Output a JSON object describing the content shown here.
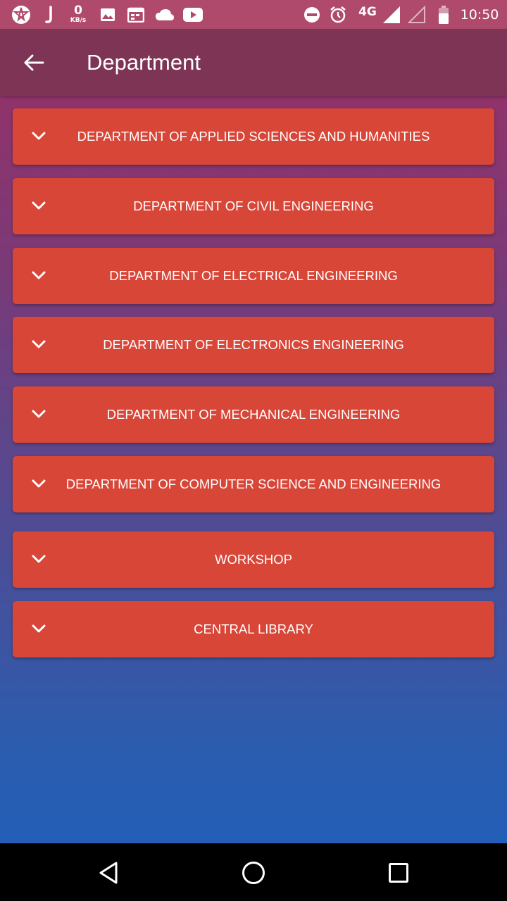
{
  "status_bar": {
    "speed_value": "0",
    "speed_unit": "KB/s",
    "network": "4G",
    "time": "10:50"
  },
  "header": {
    "title": "Department",
    "back_icon": "arrow-left-icon"
  },
  "departments": [
    {
      "label": "DEPARTMENT OF APPLIED SCIENCES AND HUMANITIES"
    },
    {
      "label": "DEPARTMENT OF CIVIL ENGINEERING"
    },
    {
      "label": "DEPARTMENT OF ELECTRICAL ENGINEERING"
    },
    {
      "label": "DEPARTMENT OF ELECTRONICS ENGINEERING"
    },
    {
      "label": "DEPARTMENT OF MECHANICAL ENGINEERING"
    },
    {
      "label": "DEPARTMENT OF COMPUTER SCIENCE AND ENGINEERING"
    },
    {
      "label": "WORKSHOP"
    },
    {
      "label": "CENTRAL LIBRARY"
    }
  ],
  "colors": {
    "card": "#d84638",
    "app_bar": "#7e3454",
    "status_bar": "#b04a6c"
  }
}
